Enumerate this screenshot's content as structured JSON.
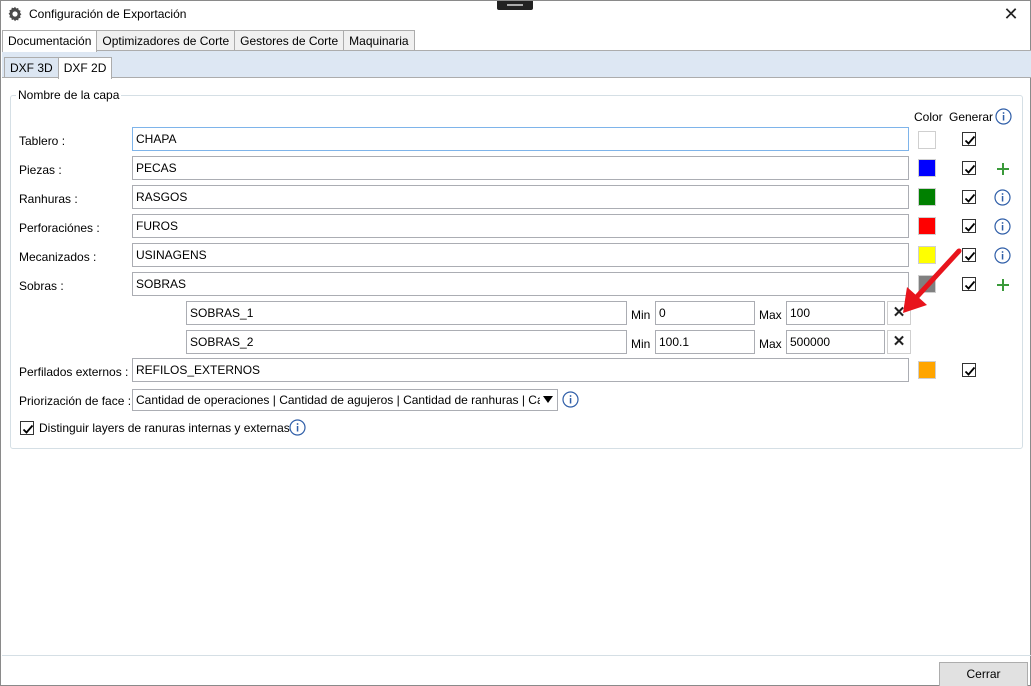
{
  "window": {
    "title": "Configuración de Exportación"
  },
  "tabs": [
    "Documentación",
    "Optimizadores de Corte",
    "Gestores de Corte",
    "Maquinaria"
  ],
  "subtabs": [
    "DXF 3D",
    "DXF 2D"
  ],
  "group": {
    "title": "Nombre de la capa",
    "color_header": "Color",
    "generar_header": "Generar"
  },
  "rows": [
    {
      "label": "Tablero :",
      "value": "CHAPA",
      "color": "#ffffff",
      "checked": true
    },
    {
      "label": "Piezas :",
      "value": "PECAS",
      "color": "#0000ff",
      "checked": true
    },
    {
      "label": "Ranhuras :",
      "value": "RASGOS",
      "color": "#008000",
      "checked": true
    },
    {
      "label": "Perforaciónes :",
      "value": "FUROS",
      "color": "#ff0000",
      "checked": true
    },
    {
      "label": "Mecanizados :",
      "value": "USINAGENS",
      "color": "#ffff00",
      "checked": true
    },
    {
      "label": "Sobras :",
      "value": "SOBRAS",
      "color": "#808080",
      "checked": true
    }
  ],
  "sobras_items": [
    {
      "name": "SOBRAS_1",
      "min_label": "Min",
      "min": "0",
      "max_label": "Max",
      "max": "100"
    },
    {
      "name": "SOBRAS_2",
      "min_label": "Min",
      "min": "100.1",
      "max_label": "Max",
      "max": "500000"
    }
  ],
  "perfilados": {
    "label": "Perfilados externos :",
    "value": "REFILOS_EXTERNOS",
    "color": "#ffa500",
    "checked": true
  },
  "priorizacion": {
    "label": "Priorización de face :",
    "value": "Cantidad de operaciones | Cantidad de agujeros | Cantidad de ranhuras | Cantidad de mecanizados"
  },
  "distinguir": {
    "label": "Distinguir layers de ranuras internas y externas",
    "checked": true
  },
  "footer": {
    "close_label": "Cerrar"
  },
  "annotation_color": "#e8141c"
}
